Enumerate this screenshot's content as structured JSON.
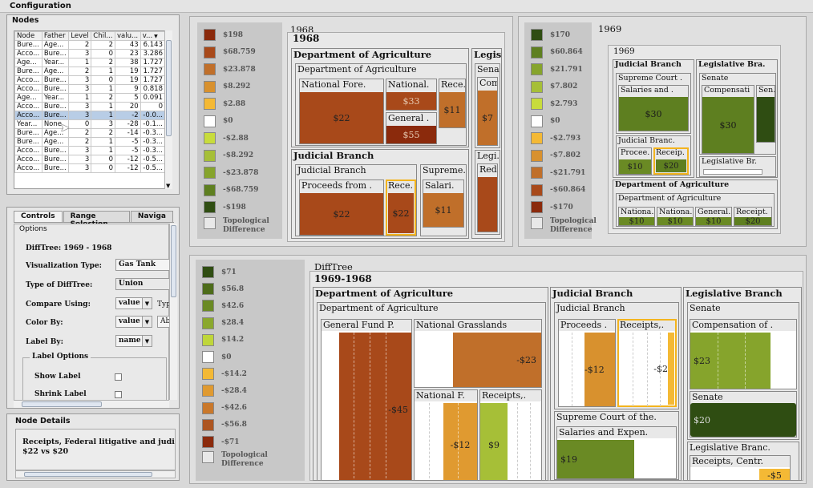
{
  "window": {
    "title": "Configuration"
  },
  "nodes_panel": {
    "title": "Nodes",
    "columns": [
      "Node",
      "Father",
      "Level",
      "Chil...",
      "valu...",
      "v..."
    ],
    "sort_icon": "sort-descending-icon",
    "rows": [
      [
        "Bure...",
        "Age...",
        "2",
        "2",
        "43",
        "6.143"
      ],
      [
        "Acco...",
        "Bure...",
        "3",
        "0",
        "23",
        "3.286"
      ],
      [
        "Age...",
        "Year...",
        "1",
        "2",
        "38",
        "1.727"
      ],
      [
        "Bure...",
        "Age...",
        "2",
        "1",
        "19",
        "1.727"
      ],
      [
        "Acco...",
        "Bure...",
        "3",
        "0",
        "19",
        "1.727"
      ],
      [
        "Acco...",
        "Bure...",
        "3",
        "1",
        "9",
        "0.818"
      ],
      [
        "Age...",
        "Year...",
        "1",
        "2",
        "5",
        "0.091"
      ],
      [
        "Acco...",
        "Bure...",
        "3",
        "1",
        "20",
        "0"
      ],
      [
        "Acco...",
        "Bure...",
        "3",
        "1",
        "-2",
        "-0.0..."
      ],
      [
        "Year...",
        "None",
        "0",
        "3",
        "-28",
        "-0.1..."
      ],
      [
        "Bure...",
        "Age...",
        "2",
        "2",
        "-14",
        "-0.3..."
      ],
      [
        "Bure...",
        "Age...",
        "2",
        "1",
        "-5",
        "-0.3..."
      ],
      [
        "Acco...",
        "Bure...",
        "3",
        "1",
        "-5",
        "-0.3..."
      ],
      [
        "Acco...",
        "Bure...",
        "3",
        "0",
        "-12",
        "-0.5..."
      ],
      [
        "Acco...",
        "Bure...",
        "3",
        "0",
        "-12",
        "-0.5..."
      ]
    ],
    "selected_row": 8
  },
  "controls_panel": {
    "tabs": [
      "Controls",
      "Range Selection",
      "Naviga"
    ],
    "group": "Options",
    "difftree_label": "DiffTree: 1969 - 1968",
    "vis_type_label": "Visualization Type:",
    "vis_type_value": "Gas Tank",
    "type_label": "Type of DiffTree:",
    "type_value": "Union",
    "compare_label": "Compare Using:",
    "compare_value": "value",
    "compare_extra": "Typ",
    "color_label": "Color By:",
    "color_value": "value",
    "color_extra": "Ab",
    "labelby_label": "Label By:",
    "labelby_value": "name",
    "label_options": "Label Options",
    "show_label": "Show Label",
    "shrink_label": "Shrink Label"
  },
  "details_panel": {
    "title": "Node Details",
    "text1": "Receipts, Federal litigative and judici",
    "text2": "$22 vs $20"
  },
  "legend_1968": {
    "items": [
      [
        "$198",
        "#8b2a0c"
      ],
      [
        "$68.759",
        "#a8491a"
      ],
      [
        "$23.878",
        "#c06f2a"
      ],
      [
        "$8.292",
        "#d8912e"
      ],
      [
        "$2.88",
        "#f4b935"
      ],
      [
        "$0",
        "#ffffff"
      ],
      [
        "-$2.88",
        "#c8dc3c"
      ],
      [
        "-$8.292",
        "#a6bf37"
      ],
      [
        "-$23.878",
        "#86a42c"
      ],
      [
        "-$68.759",
        "#5e7f20"
      ],
      [
        "-$198",
        "#2f4d12"
      ]
    ],
    "topo": "Topological Difference"
  },
  "legend_1969": {
    "items": [
      [
        "$170",
        "#2f4d12"
      ],
      [
        "$60.864",
        "#5e7f20"
      ],
      [
        "$21.791",
        "#86a42c"
      ],
      [
        "$7.802",
        "#a6bf37"
      ],
      [
        "$2.793",
        "#c8dc3c"
      ],
      [
        "$0",
        "#ffffff"
      ],
      [
        "-$2.793",
        "#f4b935"
      ],
      [
        "-$7.802",
        "#d8912e"
      ],
      [
        "-$21.791",
        "#c06f2a"
      ],
      [
        "-$60.864",
        "#a8491a"
      ],
      [
        "-$170",
        "#8b2a0c"
      ]
    ],
    "topo": "Topological Difference"
  },
  "legend_diff": {
    "items": [
      [
        "$71",
        "#2f4d12"
      ],
      [
        "$56.8",
        "#4d6c1a"
      ],
      [
        "$42.6",
        "#6a8a24"
      ],
      [
        "$28.4",
        "#8aa82d"
      ],
      [
        "$14.2",
        "#bfd63a"
      ],
      [
        "$0",
        "#ffffff"
      ],
      [
        "-$14.2",
        "#f4b935"
      ],
      [
        "-$28.4",
        "#e09a30"
      ],
      [
        "-$42.6",
        "#c9782b"
      ],
      [
        "-$56.8",
        "#ad5520"
      ],
      [
        "-$71",
        "#8b2a0c"
      ]
    ],
    "topo": "Topological Difference"
  },
  "tm1968": {
    "outer": "1968",
    "inner": "1968",
    "agri": "Department of Agriculture",
    "agri_sub": "Department of Agriculture",
    "nf": "National Fore.",
    "nf_v": "$22",
    "nat": "National.",
    "nat_v": "$33",
    "gen": "General .",
    "gen_v": "$55",
    "rec": "Rece.",
    "rec_v": "$11",
    "jud": "Judicial Branch",
    "jud_sub": "Judicial Branch",
    "proc": "Proceeds from .",
    "proc_v": "$22",
    "rec2": "Rece.",
    "rec2_v": "$22",
    "sup": "Supreme.",
    "sal": "Salari.",
    "sal_v": "$11",
    "leg": "Legis.",
    "sena": "Sena.",
    "com": "Com.",
    "com_v": "$7",
    "legi": "Legi.",
    "red": "Red."
  },
  "tm1969": {
    "outer": "1969",
    "inner": "1969",
    "jud": "Judicial Branch",
    "sup": "Supreme Court .",
    "sal": "Salaries and .",
    "sal_v": "$30",
    "jud2": "Judicial Branc.",
    "proc": "Procee.",
    "proc_v": "$10",
    "rec": "Receip.",
    "rec_v": "$20",
    "leg": "Legislative Bra.",
    "senate": "Senate",
    "comp": "Compensati",
    "comp_v": "$30",
    "sen": "Sen.",
    "legbr": "Legislative Br.",
    "agri": "Department of Agriculture",
    "agri_sub": "Department of Agriculture",
    "a1": "Nationa.",
    "a1_v": "$10",
    "a2": "Nationa.",
    "a2_v": "$10",
    "a3": "General.",
    "a3_v": "$10",
    "a4": "Receipt.",
    "a4_v": "$20"
  },
  "tmdiff": {
    "outer": "DiffTree",
    "inner": "1969-1968",
    "agri": "Department of Agriculture",
    "agri_sub": "Department of Agriculture",
    "gf": "General Fund P.",
    "gf_v": "-$45",
    "ng": "National Grasslands",
    "ng_v": "-$23",
    "nf": "National F.",
    "nf_v": "-$12",
    "rc": "Receipts,.",
    "rc_v": "$9",
    "jud": "Judicial Branch",
    "jud_sub": "Judicial Branch",
    "proc": "Proceeds .",
    "proc_v": "-$12",
    "recj": "Receipts,.",
    "recj_v": "-$2",
    "sup": "Supreme Court of the.",
    "sal": "Salaries and Expen.",
    "sal_v": "$19",
    "leg": "Legislative Branch",
    "senate": "Senate",
    "comp": "Compensation of .",
    "comp_v": "$23",
    "senate2": "Senate",
    "senate2_v": "$20",
    "legbr": "Legislative Branc.",
    "rcen": "Receipts, Centr.",
    "rcen_v": "-$5"
  }
}
